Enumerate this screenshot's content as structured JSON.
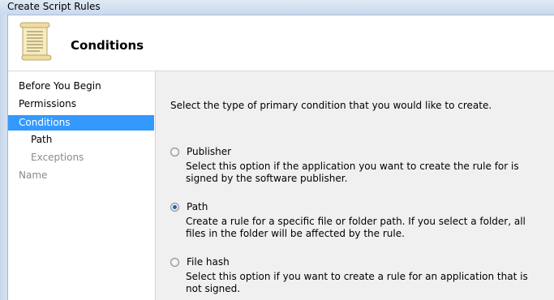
{
  "window": {
    "title": "Create Script Rules"
  },
  "header": {
    "title": "Conditions",
    "icon": "scroll-icon"
  },
  "nav": {
    "items": [
      {
        "label": "Before You Begin"
      },
      {
        "label": "Permissions"
      },
      {
        "label": "Conditions"
      },
      {
        "label": "Path"
      },
      {
        "label": "Exceptions"
      },
      {
        "label": "Name"
      }
    ]
  },
  "main": {
    "prompt": "Select the type of primary condition that you would like to create.",
    "options": [
      {
        "label": "Publisher",
        "checked": false,
        "description": "Select this option if the application you want to create the rule for is signed by the software publisher."
      },
      {
        "label": "Path",
        "checked": true,
        "description": "Create a rule for a specific file or folder path. If you select a folder, all files in the folder will be affected by the rule."
      },
      {
        "label": "File hash",
        "checked": false,
        "description": "Select this option if you want to create a rule for an application that is not signed."
      }
    ]
  },
  "colors": {
    "selection": "#3399ff",
    "content_bg": "#f0f0f0"
  }
}
